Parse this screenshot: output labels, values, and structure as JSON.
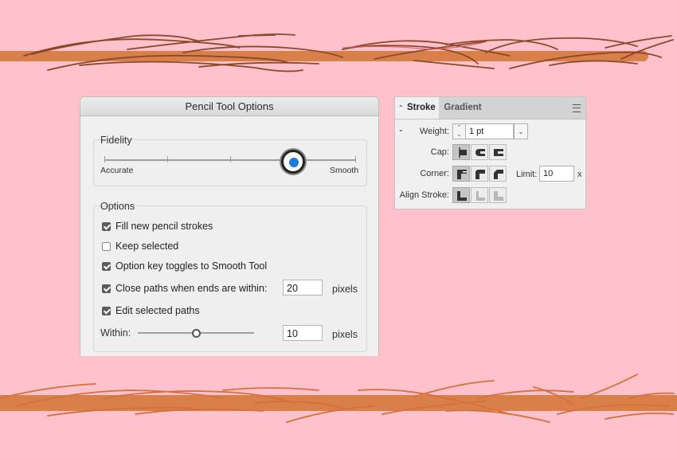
{
  "canvas": {
    "background": "#ffc2cd",
    "top_bar_color": "#d9804a",
    "top_stroke_color": "#8a4a2a",
    "bottom_bar_color": "#d9804a",
    "bottom_stroke_color": "#d4703a"
  },
  "pencil_dialog": {
    "title": "Pencil Tool Options",
    "fidelity": {
      "label": "Fidelity",
      "min_label": "Accurate",
      "max_label": "Smooth",
      "value_fraction": 0.75,
      "thumb_color": "#1f7ae0"
    },
    "options": {
      "label": "Options",
      "fill_new": {
        "label": "Fill new pencil strokes",
        "checked": true
      },
      "keep_selected": {
        "label": "Keep selected",
        "checked": false
      },
      "option_key": {
        "label": "Option key toggles to Smooth Tool",
        "checked": true
      },
      "close_paths": {
        "label": "Close paths when ends are within:",
        "checked": true,
        "value": "20",
        "unit": "pixels"
      },
      "edit_selected": {
        "label": "Edit selected paths",
        "checked": true
      },
      "within": {
        "label": "Within:",
        "value": "10",
        "unit": "pixels",
        "value_fraction": 0.5
      }
    }
  },
  "stroke_panel": {
    "tabs": {
      "active": "Stroke",
      "inactive": "Gradient"
    },
    "weight": {
      "label": "Weight:",
      "value": "1 pt"
    },
    "cap": {
      "label": "Cap:",
      "icons": [
        "butt-cap-icon",
        "round-cap-icon",
        "projecting-cap-icon"
      ],
      "selected": 0
    },
    "corner": {
      "label": "Corner:",
      "icons": [
        "miter-join-icon",
        "round-join-icon",
        "bevel-join-icon"
      ],
      "selected": 0
    },
    "limit": {
      "label": "Limit:",
      "value": "10",
      "unit": "x"
    },
    "align": {
      "label": "Align Stroke:",
      "icons": [
        "align-center-icon",
        "align-inside-icon",
        "align-outside-icon"
      ],
      "selected": 0
    }
  }
}
